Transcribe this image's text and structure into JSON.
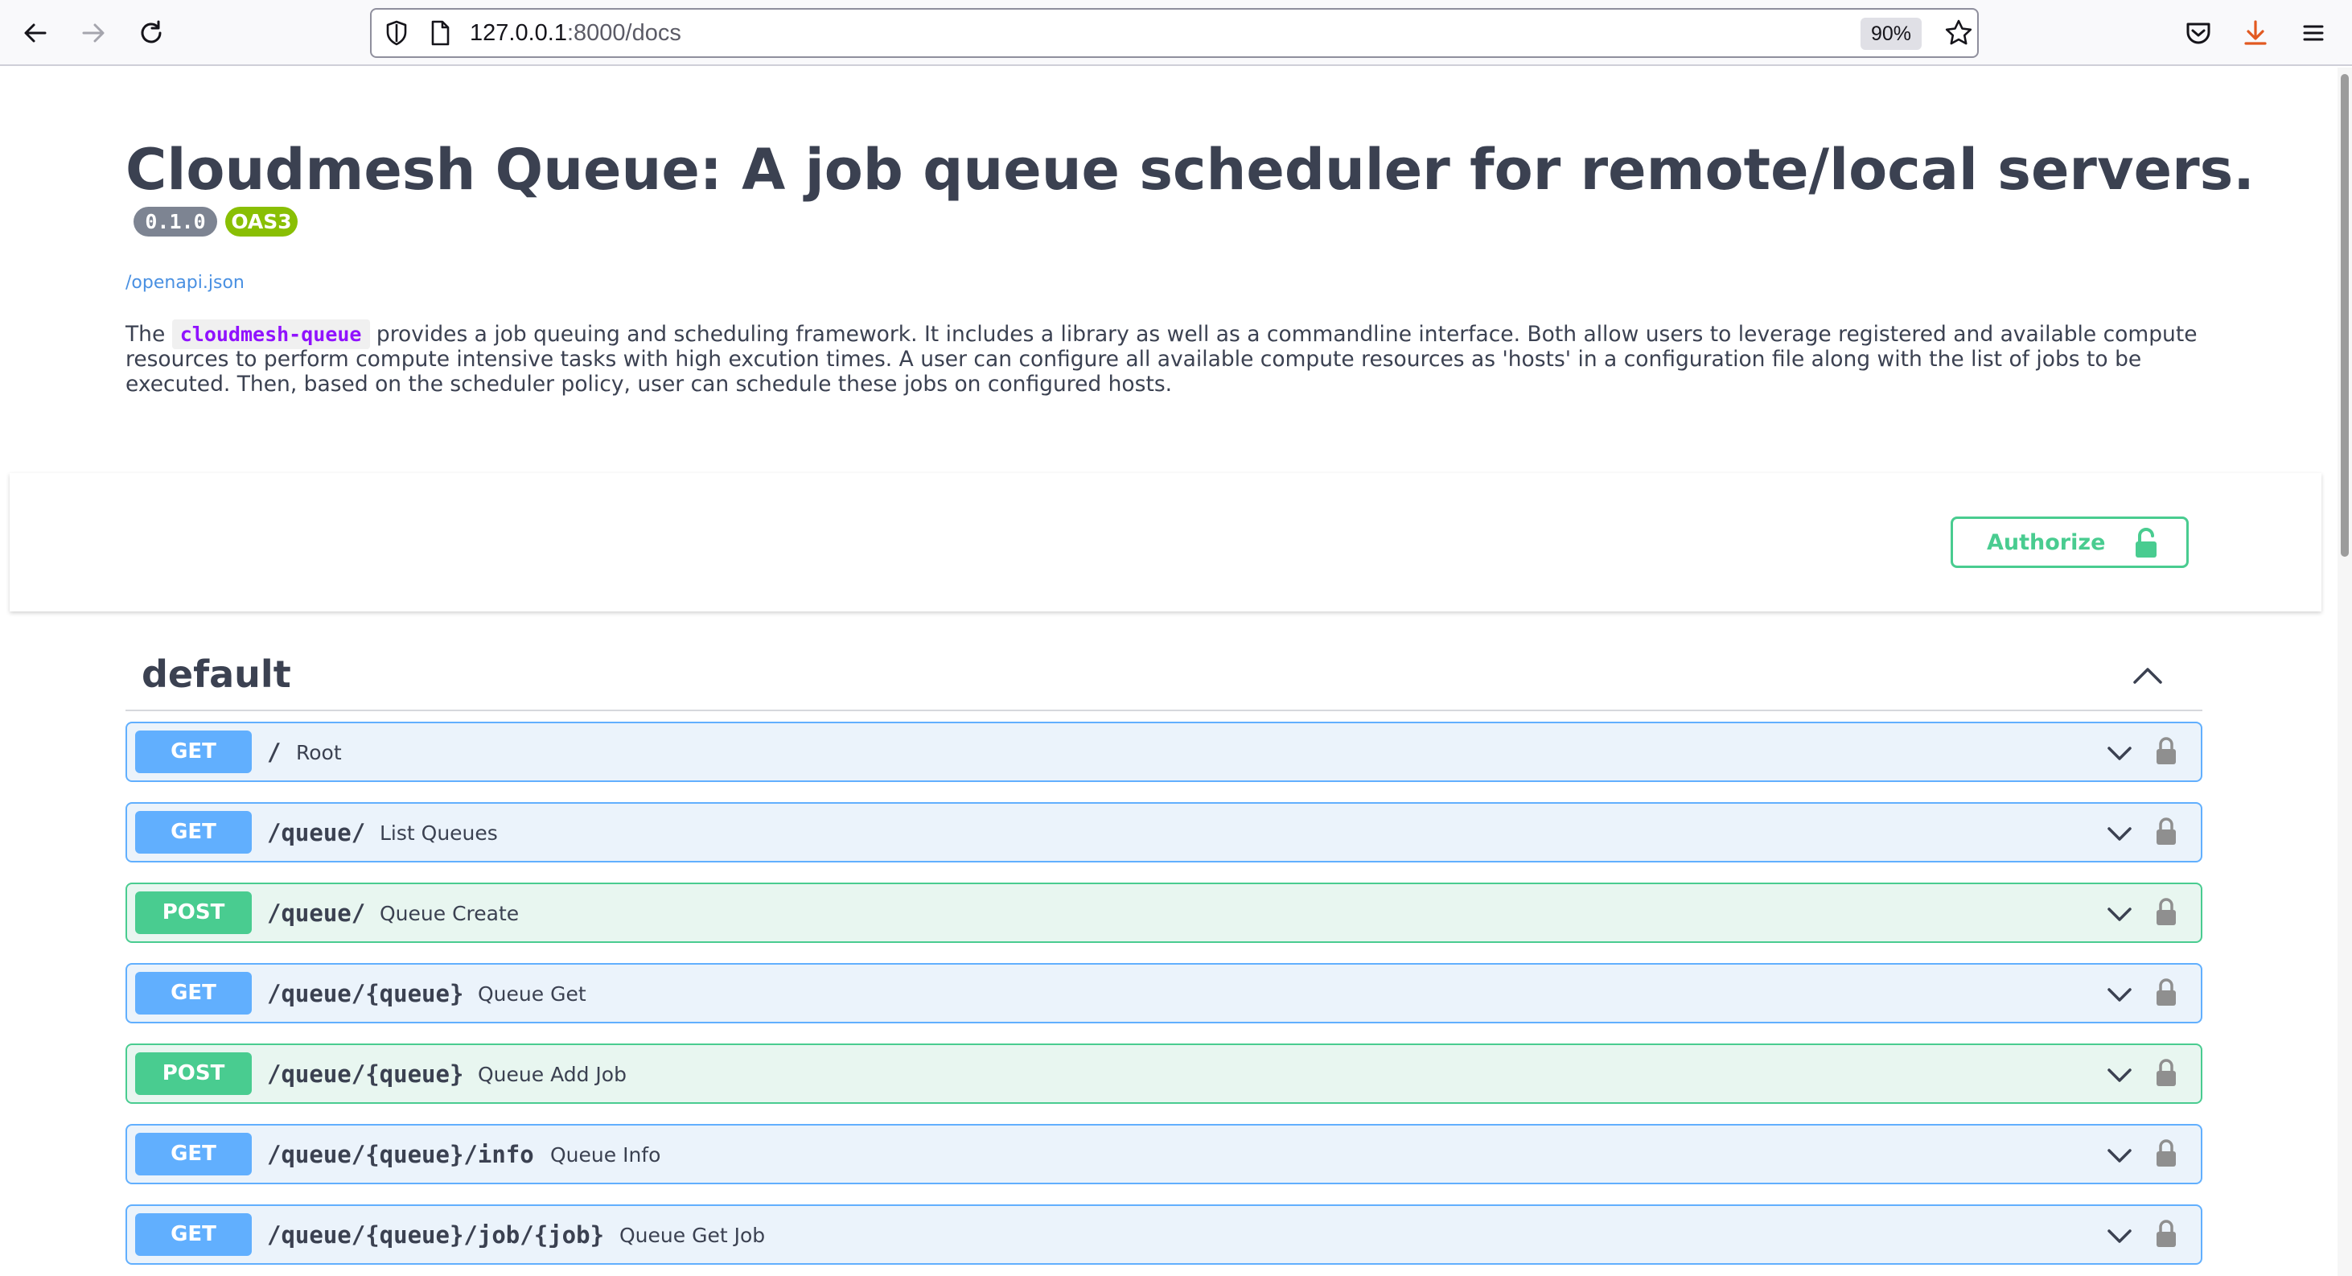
{
  "browser": {
    "url_host": "127.0.0.1",
    "url_rest": ":8000/docs",
    "zoom": "90%"
  },
  "info": {
    "title": "Cloudmesh Queue: A job queue scheduler for remote/local servers.",
    "version": "0.1.0",
    "oas_badge": "OAS3",
    "spec_link": "/openapi.json",
    "description_prefix": "The ",
    "description_code": "cloudmesh-queue",
    "description_suffix": " provides a job queuing and scheduling framework. It includes a library as well as a commandline interface. Both allow users to leverage registered and available compute resources to perform compute intensive tasks with high excution times. A user can configure all available compute resources as 'hosts' in a configuration file along with the list of jobs to be executed. Then, based on the scheduler policy, user can schedule these jobs on configured hosts."
  },
  "auth": {
    "label": "Authorize"
  },
  "tag": {
    "name": "default"
  },
  "operations": [
    {
      "method": "GET",
      "path": "/",
      "summary": "Root"
    },
    {
      "method": "GET",
      "path": "/queue/",
      "summary": "List Queues"
    },
    {
      "method": "POST",
      "path": "/queue/",
      "summary": "Queue Create"
    },
    {
      "method": "GET",
      "path": "/queue/{queue}",
      "summary": "Queue Get"
    },
    {
      "method": "POST",
      "path": "/queue/{queue}",
      "summary": "Queue Add Job"
    },
    {
      "method": "GET",
      "path": "/queue/{queue}/info",
      "summary": "Queue Info"
    },
    {
      "method": "GET",
      "path": "/queue/{queue}/job/{job}",
      "summary": "Queue Get Job"
    }
  ],
  "colors": {
    "get": "#61affe",
    "post": "#49cc90",
    "text": "#3b4151",
    "code": "#9012fe",
    "link": "#4990e2"
  }
}
